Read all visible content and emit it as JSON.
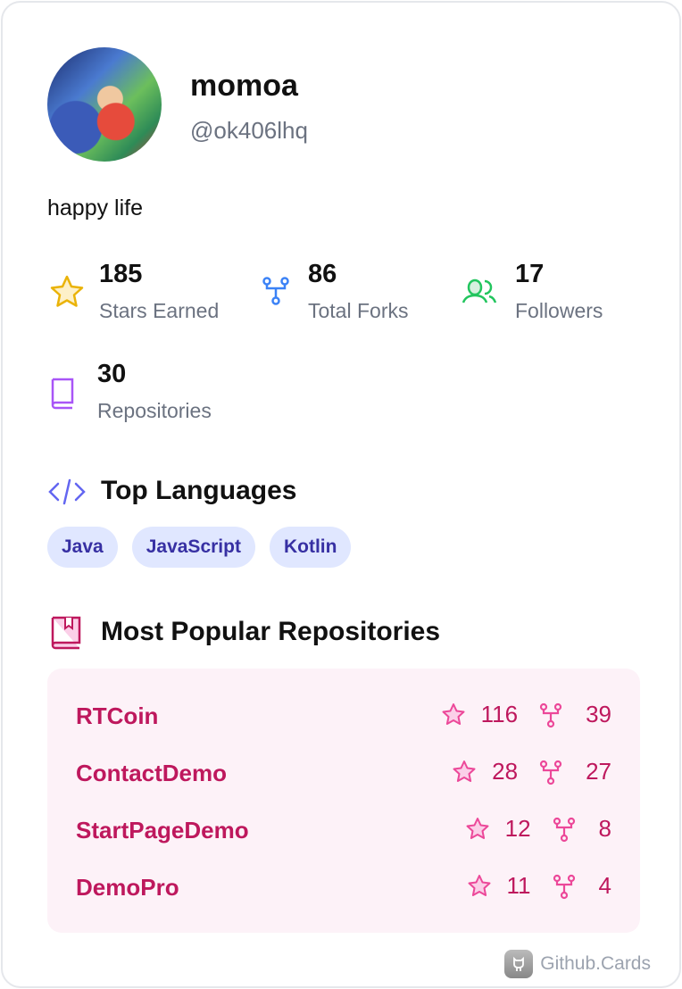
{
  "profile": {
    "name": "momoa",
    "handle": "@ok406lhq",
    "bio": "happy life"
  },
  "stats": [
    {
      "value": "185",
      "label": "Stars Earned",
      "icon": "star-icon",
      "color": "#eab308"
    },
    {
      "value": "86",
      "label": "Total Forks",
      "icon": "fork-icon",
      "color": "#3b82f6"
    },
    {
      "value": "17",
      "label": "Followers",
      "icon": "users-icon",
      "color": "#22c55e"
    },
    {
      "value": "30",
      "label": "Repositories",
      "icon": "book-icon",
      "color": "#a855f7"
    }
  ],
  "languages": {
    "title": "Top Languages",
    "items": [
      "Java",
      "JavaScript",
      "Kotlin"
    ]
  },
  "repositories": {
    "title": "Most Popular Repositories",
    "items": [
      {
        "name": "RTCoin",
        "stars": "116",
        "forks": "39"
      },
      {
        "name": "ContactDemo",
        "stars": "28",
        "forks": "27"
      },
      {
        "name": "StartPageDemo",
        "stars": "12",
        "forks": "8"
      },
      {
        "name": "DemoPro",
        "stars": "11",
        "forks": "4"
      }
    ]
  },
  "footer": {
    "brand": "Github.Cards"
  }
}
